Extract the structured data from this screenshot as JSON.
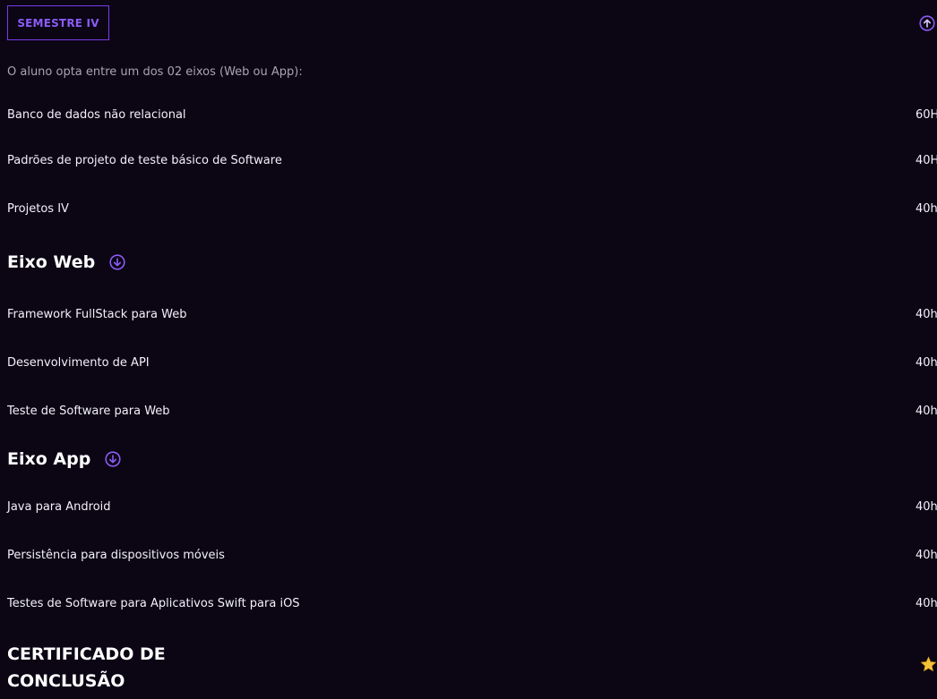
{
  "semester": {
    "label": "SEMESTRE IV",
    "intro": "O aluno opta entre um dos 02 eixos (Web ou App):",
    "collapse_icon": "arrow-up-circle-icon"
  },
  "core": [
    {
      "name": "Banco de dados não relacional",
      "hours": "60H"
    },
    {
      "name": "Padrões de projeto de teste básico de Software",
      "hours": "40H"
    },
    {
      "name": "Projetos IV",
      "hours": "40h"
    }
  ],
  "axes": [
    {
      "title": "Eixo Web",
      "toggle_icon": "arrow-down-circle-icon",
      "items": [
        {
          "name": "Framework FullStack para Web",
          "hours": "40h"
        },
        {
          "name": "Desenvolvimento de API",
          "hours": "40h"
        },
        {
          "name": "Teste de Software para Web",
          "hours": "40h"
        }
      ]
    },
    {
      "title": "Eixo App",
      "toggle_icon": "arrow-down-circle-icon",
      "items": [
        {
          "name": "Java para Android",
          "hours": "40h"
        },
        {
          "name": "Persistência para dispositivos móveis",
          "hours": "40h"
        },
        {
          "name": "Testes de Software para Aplicativos Swift para iOS",
          "hours": "40h"
        }
      ]
    }
  ],
  "certificate": {
    "line1": "CERTIFICADO DE",
    "line2": "CONCLUSÃO",
    "icon": "star-icon"
  },
  "colors": {
    "background": "#0b0514",
    "accent": "#8b5cf6",
    "star": "#f5c33b"
  }
}
